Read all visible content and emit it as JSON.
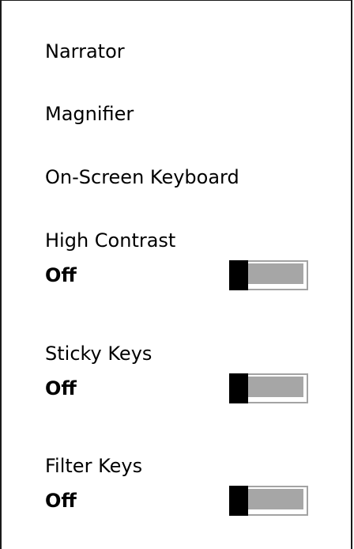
{
  "menu": {
    "items": [
      {
        "label": "Narrator"
      },
      {
        "label": "Magnifier"
      },
      {
        "label": "On-Screen Keyboard"
      }
    ]
  },
  "toggles": [
    {
      "title": "High Contrast",
      "state": "Off",
      "on": false
    },
    {
      "title": "Sticky Keys",
      "state": "Off",
      "on": false
    },
    {
      "title": "Filter Keys",
      "state": "Off",
      "on": false
    }
  ],
  "colors": {
    "thumb": "#000000",
    "track_fill": "#a6a6a6",
    "track_border": "#a3a3a3",
    "background": "#ffffff"
  }
}
